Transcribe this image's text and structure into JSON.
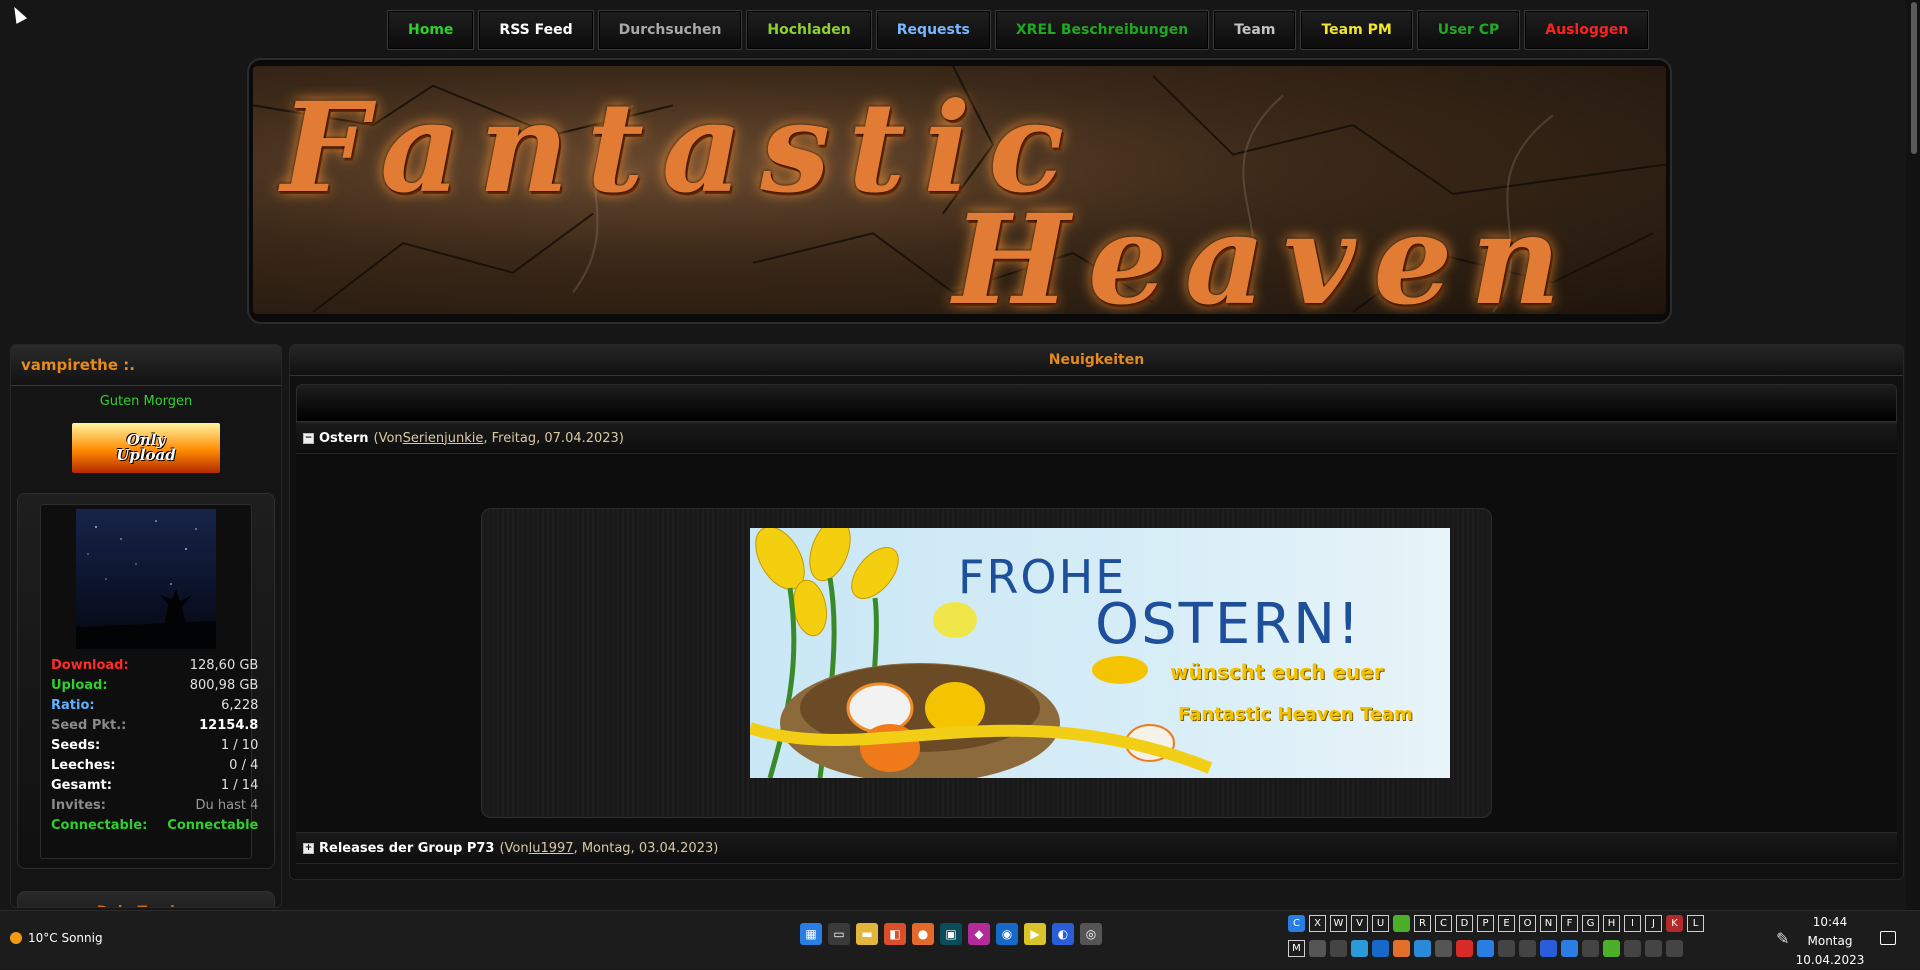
{
  "nav": {
    "items": [
      {
        "label": "Home",
        "color": "#2dd12d"
      },
      {
        "label": "RSS Feed",
        "color": "#ffffff"
      },
      {
        "label": "Durchsuchen",
        "color": "#a8a8a8"
      },
      {
        "label": "Hochladen",
        "color": "#8ed12d"
      },
      {
        "label": "Requests",
        "color": "#77b8ff"
      },
      {
        "label": "XREL Beschreibungen",
        "color": "#20a820"
      },
      {
        "label": "Team",
        "color": "#c2c2c2"
      },
      {
        "label": "Team PM",
        "color": "#f2e52c"
      },
      {
        "label": "User CP",
        "color": "#22a822"
      },
      {
        "label": "Ausloggen",
        "color": "#ff2020"
      }
    ]
  },
  "banner": {
    "line1": "Fantastic",
    "line2": "Heaven"
  },
  "sidebar": {
    "username": "vampirethe :.",
    "greeting": "Guten Morgen",
    "badge_line1": "Only",
    "badge_line2": "Upload",
    "stats": [
      {
        "label": "Download:",
        "value": "128,60 GB"
      },
      {
        "label": "Upload:",
        "value": "800,98 GB"
      },
      {
        "label": "Ratio:",
        "value": "6,228"
      },
      {
        "label": "Seed Pkt.:",
        "value": "12154.8"
      },
      {
        "label": "Seeds:",
        "value": "1 / 10"
      },
      {
        "label": "Leeches:",
        "value": "0 / 4"
      },
      {
        "label": "Gesamt:",
        "value": "1 / 14"
      },
      {
        "label": "Invites:",
        "value": "Du hast 4"
      },
      {
        "label": "Connectable:",
        "value": "Connectable"
      }
    ],
    "tracker_title": "Dein Tracker"
  },
  "main": {
    "title": "Neuigkeiten",
    "news": [
      {
        "toggle": "−",
        "title": "Ostern",
        "prefix": "(Von ",
        "author": "Serienjunkie",
        "suffix": ", Freitag, 07.04.2023)"
      },
      {
        "toggle": "+",
        "title": "Releases der Group P73",
        "prefix": "(Von ",
        "author": "lu1997",
        "suffix": ", Montag, 03.04.2023)"
      }
    ],
    "easter": {
      "line1": "FROHE",
      "line2": "OSTERN!",
      "line3": "wünscht euch euer",
      "line4": "Fantastic Heaven Team"
    }
  },
  "taskbar": {
    "weather": "10°C Sonnig",
    "tray_row1": [
      "C",
      "X",
      "W",
      "V",
      "U",
      "",
      "R",
      "C",
      "D",
      "P",
      "E",
      "O",
      "N",
      "F",
      "G",
      "H",
      "I",
      "J",
      "K",
      "L"
    ],
    "tray_row2": [
      "M",
      "",
      "",
      "",
      "",
      "",
      "",
      "",
      "",
      "",
      "",
      "",
      "",
      "",
      "",
      "",
      "",
      "",
      "",
      ""
    ],
    "clock_time": "10:44",
    "clock_day": "Montag",
    "clock_date": "10.04.2023"
  }
}
